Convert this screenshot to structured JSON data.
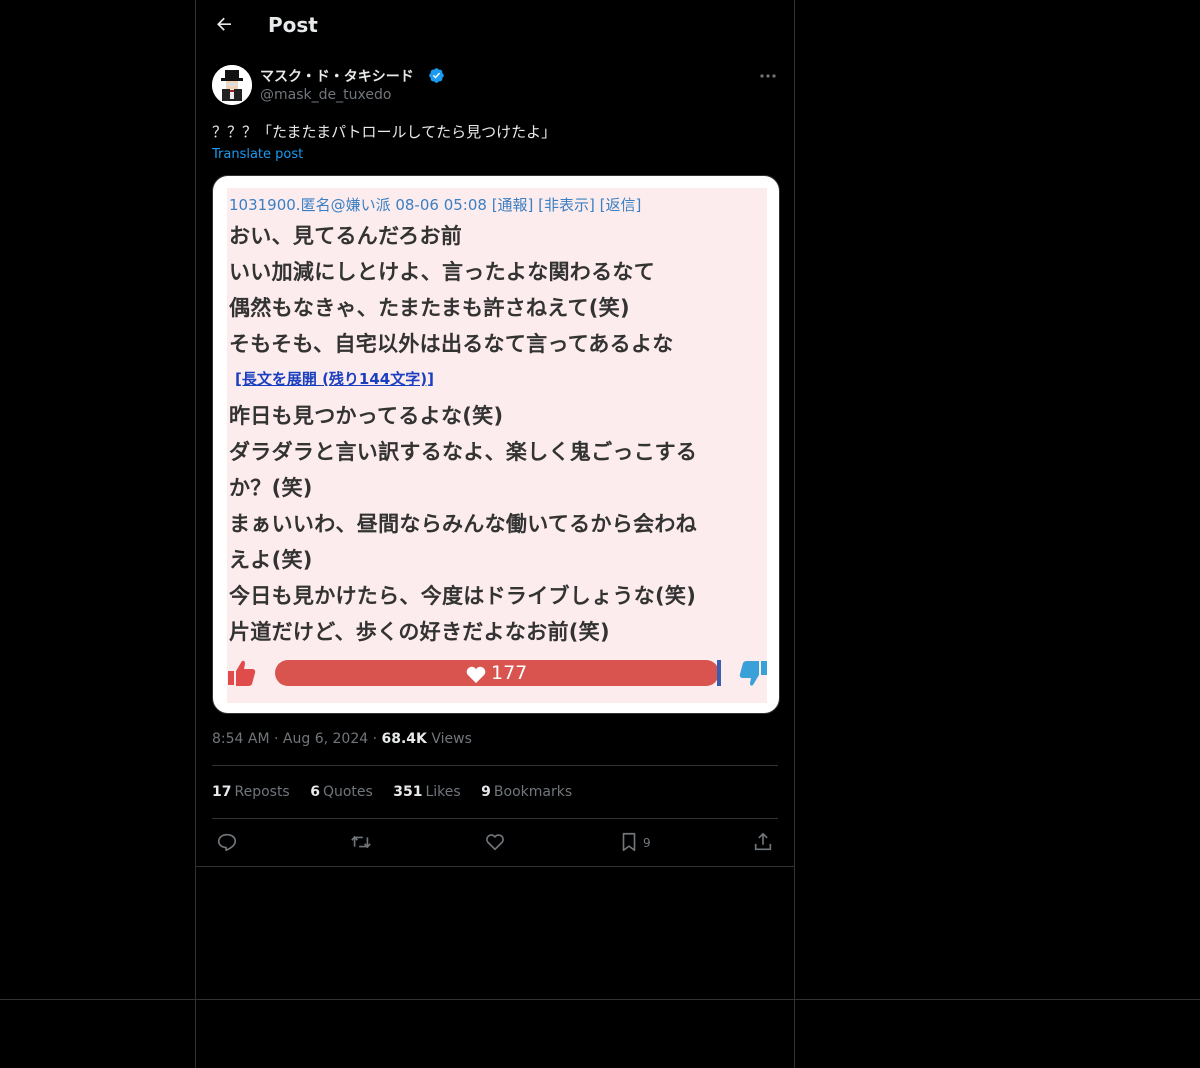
{
  "header": {
    "title": "Post"
  },
  "author": {
    "name": "マスク・ド・タキシード",
    "handle": "@mask_de_tuxedo"
  },
  "post": {
    "text": "？？？「たまたまパトロールしてたら見つけたよ」",
    "translate_label": "Translate post"
  },
  "media": {
    "header": "1031900.匿名@嫌い派 08-06 05:08  [通報]  [非表示]  [返信]",
    "lines_top": [
      "おい、見てるんだろお前",
      "いい加減にしとけよ、言ったよな関わるなて",
      "偶然もなきゃ、たまたまも許さねえて(笑)",
      "そもそも、自宅以外は出るなて言ってあるよな"
    ],
    "expand_link": "[長文を展開 (残り144文字)]",
    "lines_bottom": [
      "昨日も見つかってるよな(笑)",
      "ダラダラと言い訳するなよ、楽しく鬼ごっこする",
      "か？(笑)",
      "まぁいいわ、昼間ならみんな働いてるから会わね",
      "えよ(笑)",
      "今日も見かけたら、今度はドライブしょうな(笑)",
      "片道だけど、歩くの好きだよなお前(笑)"
    ],
    "vote_count": "177"
  },
  "meta": {
    "time": "8:54 AM",
    "date": "Aug 6, 2024",
    "views_count": "68.4K",
    "views_label": "Views"
  },
  "stats": {
    "reposts_count": "17",
    "reposts_label": "Reposts",
    "quotes_count": "6",
    "quotes_label": "Quotes",
    "likes_count": "351",
    "likes_label": "Likes",
    "bookmarks_count": "9",
    "bookmarks_label": "Bookmarks"
  },
  "actions": {
    "bookmark_count": "9"
  },
  "colors": {
    "accent": "#1d9bf0",
    "border": "#2f3336",
    "muted": "#71767b",
    "vote_bar": "#d9534f"
  }
}
